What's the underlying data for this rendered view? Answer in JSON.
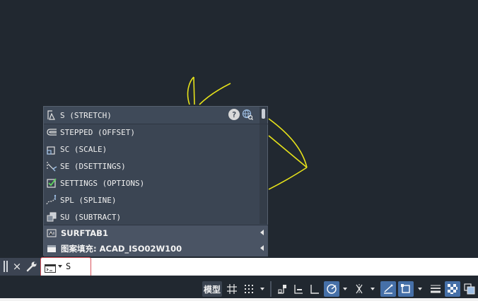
{
  "autocomplete": {
    "items": [
      {
        "label": "S (STRETCH)",
        "icon": "stretch-icon"
      },
      {
        "label": "STEPPED (OFFSET)",
        "icon": "offset-icon"
      },
      {
        "label": "SC (SCALE)",
        "icon": "scale-icon"
      },
      {
        "label": "SE (DSETTINGS)",
        "icon": "dsettings-icon"
      },
      {
        "label": "SETTINGS (OPTIONS)",
        "icon": "options-check-icon"
      },
      {
        "label": "SPL (SPLINE)",
        "icon": "spline-icon"
      },
      {
        "label": "SU (SUBTRACT)",
        "icon": "subtract-icon"
      }
    ],
    "groups": [
      {
        "label": "SURFTAB1",
        "icon": "system-variable-icon"
      },
      {
        "label": "图案填充: ACAD_ISO02W100",
        "icon": "hatch-pattern-icon"
      }
    ],
    "help_label": "?"
  },
  "command_line": {
    "input_value": "S",
    "close_glyph": "×"
  },
  "status_bar": {
    "model_label": "模型"
  },
  "colors": {
    "canvas": "#212830",
    "sketch_stroke": "#e6e21a",
    "popup": "#3b4553",
    "focus_border": "#d9525b",
    "active_toggle": "#4670a8"
  }
}
